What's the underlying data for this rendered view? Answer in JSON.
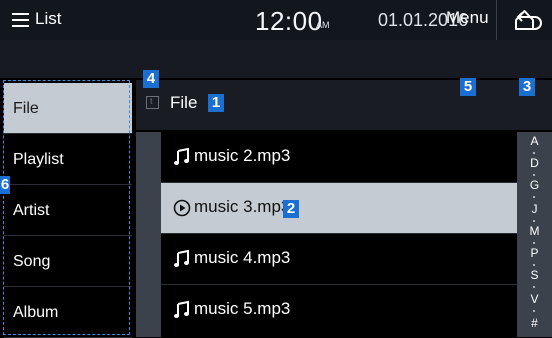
{
  "status": {
    "time": "12:00",
    "ampm": "AM",
    "date": "01.01.2016"
  },
  "title_bar": {
    "list_label": "List",
    "menu_label": "Menu"
  },
  "sidebar": {
    "items": [
      {
        "label": "File",
        "selected": true
      },
      {
        "label": "Playlist"
      },
      {
        "label": "Artist"
      },
      {
        "label": "Song"
      },
      {
        "label": "Album"
      }
    ]
  },
  "breadcrumb": {
    "label": "File"
  },
  "files": [
    {
      "name": "music 2.mp3",
      "icon": "music-note-icon"
    },
    {
      "name": "music 3.mp3",
      "icon": "play-circle-icon",
      "selected": true
    },
    {
      "name": "music 4.mp3",
      "icon": "music-note-icon"
    },
    {
      "name": "music 5.mp3",
      "icon": "music-note-icon"
    }
  ],
  "alpha_index": [
    "A",
    "D",
    "G",
    "J",
    "M",
    "P",
    "S",
    "V",
    "#"
  ],
  "callouts": {
    "c1": "1",
    "c2": "2",
    "c3": "3",
    "c4": "4",
    "c5": "5",
    "c6": "6"
  },
  "colors": {
    "accent": "#1a6fd0",
    "selected_row": "#c4cbd3",
    "index_bar": "#3b424c"
  }
}
